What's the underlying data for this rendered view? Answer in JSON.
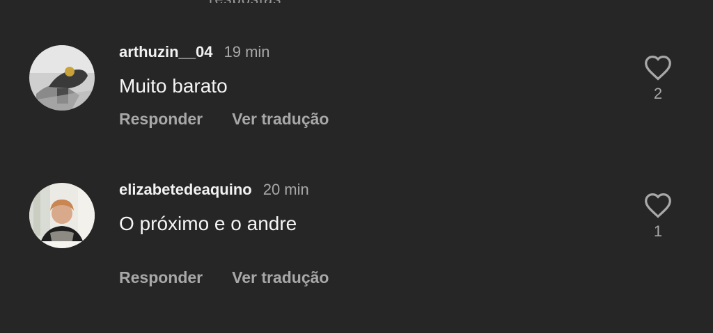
{
  "top_partial_text": "respostas",
  "comments": [
    {
      "username": "arthuzin__04",
      "time": "19 min",
      "text": "Muito barato",
      "reply_label": "Responder",
      "translate_label": "Ver tradução",
      "likes": "2",
      "icon": "heart-outline-icon"
    },
    {
      "username": "elizabetedeaquino",
      "time": "20 min",
      "text": "O próximo e o andre",
      "reply_label": "Responder",
      "translate_label": "Ver tradução",
      "likes": "1",
      "icon": "heart-outline-icon"
    }
  ],
  "colors": {
    "background": "#262626",
    "primary_text": "#f5f5f5",
    "secondary_text": "#a8a8a8"
  }
}
